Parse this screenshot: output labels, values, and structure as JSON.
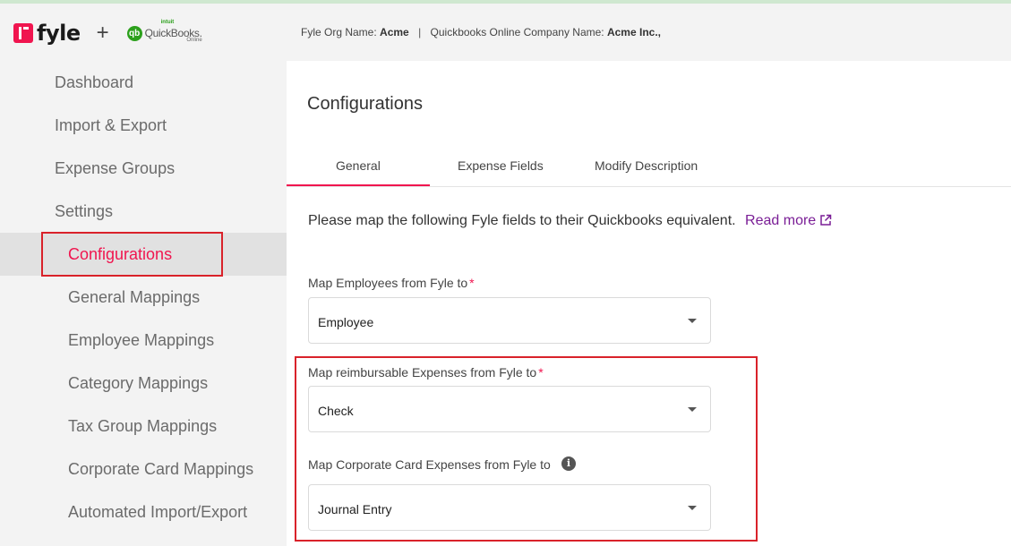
{
  "header": {
    "brand_name": "fyle",
    "plus": "+",
    "qb_brand_top": "intuit",
    "qb_brand_name": "QuickBooks.",
    "qb_brand_sub": "Online",
    "qb_mark": "qb",
    "org_label": "Fyle Org Name:",
    "org_value": "Acme",
    "separator": "|",
    "company_label": "Quickbooks Online Company Name:",
    "company_value": "Acme Inc.,"
  },
  "sidebar": {
    "items": [
      {
        "label": "Dashboard"
      },
      {
        "label": "Import & Export"
      },
      {
        "label": "Expense Groups"
      },
      {
        "label": "Settings"
      }
    ],
    "sub_items": [
      {
        "label": "Configurations",
        "active": true
      },
      {
        "label": "General Mappings"
      },
      {
        "label": "Employee Mappings"
      },
      {
        "label": "Category Mappings"
      },
      {
        "label": "Tax Group Mappings"
      },
      {
        "label": "Corporate Card Mappings"
      },
      {
        "label": "Automated Import/Export"
      }
    ]
  },
  "main": {
    "title": "Configurations",
    "tabs": [
      {
        "label": "General",
        "active": true
      },
      {
        "label": "Expense Fields"
      },
      {
        "label": "Modify Description"
      }
    ],
    "intro": "Please map the following Fyle fields to their Quickbooks equivalent.",
    "read_more": "Read more",
    "fields": [
      {
        "label": "Map Employees from Fyle to",
        "required": "*",
        "value": "Employee"
      },
      {
        "label": "Map reimbursable Expenses from Fyle to",
        "required": "*",
        "value": "Check"
      },
      {
        "label": "Map Corporate Card Expenses from Fyle to",
        "info": "i",
        "value": "Journal Entry"
      }
    ]
  },
  "colors": {
    "accent": "#f0154f",
    "link": "#7a1e96",
    "highlight_border": "#d9222a",
    "sidebar_bg": "#f3f3f3"
  }
}
